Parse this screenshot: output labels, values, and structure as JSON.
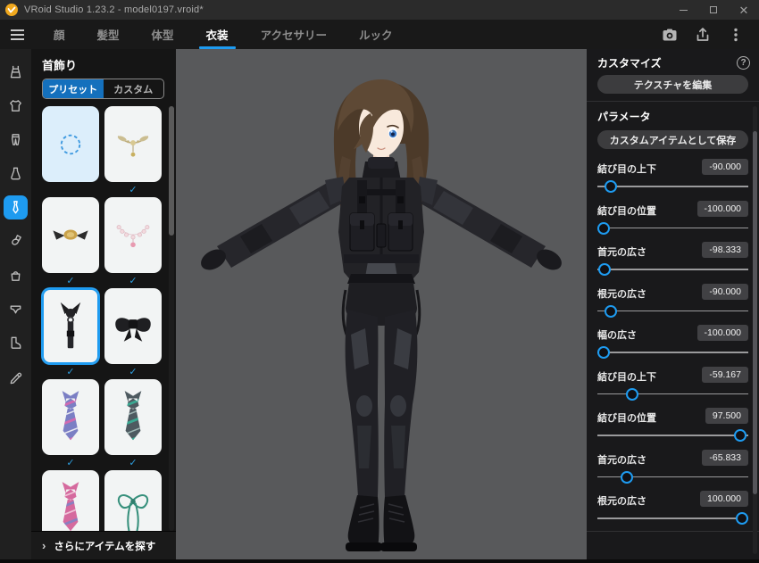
{
  "window": {
    "title": "VRoid Studio 1.23.2 - model0197.vroid*"
  },
  "navbar": {
    "tabs": [
      {
        "label": "顔",
        "active": false
      },
      {
        "label": "髪型",
        "active": false
      },
      {
        "label": "体型",
        "active": false
      },
      {
        "label": "衣装",
        "active": true
      },
      {
        "label": "アクセサリー",
        "active": false
      },
      {
        "label": "ルック",
        "active": false
      }
    ]
  },
  "icon_rail": {
    "items": [
      "onepiece",
      "tops",
      "bottoms",
      "skirt",
      "neckwear",
      "legwear",
      "bag",
      "underwear",
      "shoes",
      "pen"
    ],
    "active_item": "neckwear"
  },
  "left_panel": {
    "title": "首飾り",
    "tab_preset": "プリセット",
    "tab_custom": "カスタム",
    "more_items": "さらにアイテムを探す",
    "items": [
      {
        "name": "none",
        "checked": false,
        "selected": false
      },
      {
        "name": "gold-ornate-necklace",
        "checked": true,
        "selected": false
      },
      {
        "name": "gold-brooch-ribbon",
        "checked": true,
        "selected": false
      },
      {
        "name": "pearl-necklace",
        "checked": true,
        "selected": false
      },
      {
        "name": "black-harness-tie",
        "checked": true,
        "selected": true
      },
      {
        "name": "black-ribbon-bow",
        "checked": true,
        "selected": false
      },
      {
        "name": "purple-striped-necktie",
        "checked": true,
        "selected": false
      },
      {
        "name": "teal-striped-necktie",
        "checked": true,
        "selected": false
      },
      {
        "name": "pink-striped-necktie",
        "checked": true,
        "selected": false
      },
      {
        "name": "green-string-bow",
        "checked": true,
        "selected": false
      }
    ]
  },
  "right_panel": {
    "customize_title": "カスタマイズ",
    "edit_texture": "テクスチャを編集",
    "parameters_title": "パラメータ",
    "save_custom": "カスタムアイテムとして保存",
    "sliders": [
      {
        "label": "結び目の上下",
        "value": "-90.000"
      },
      {
        "label": "結び目の位置",
        "value": "-100.000"
      },
      {
        "label": "首元の広さ",
        "value": "-98.333"
      },
      {
        "label": "根元の広さ",
        "value": "-90.000"
      },
      {
        "label": "幅の広さ",
        "value": "-100.000"
      },
      {
        "label": "結び目の上下",
        "value": "-59.167"
      },
      {
        "label": "結び目の位置",
        "value": "97.500"
      },
      {
        "label": "首元の広さ",
        "value": "-65.833"
      },
      {
        "label": "根元の広さ",
        "value": "100.000"
      }
    ],
    "slider_range": {
      "min": -100,
      "max": 100
    }
  },
  "icons": {
    "check": "✓",
    "chevron_right": "›",
    "help": "?"
  },
  "colors": {
    "accent": "#1E9BF0",
    "preset_tab": "#1372BD",
    "check": "#2D9CDB",
    "viewport_bg": "#58595B"
  }
}
